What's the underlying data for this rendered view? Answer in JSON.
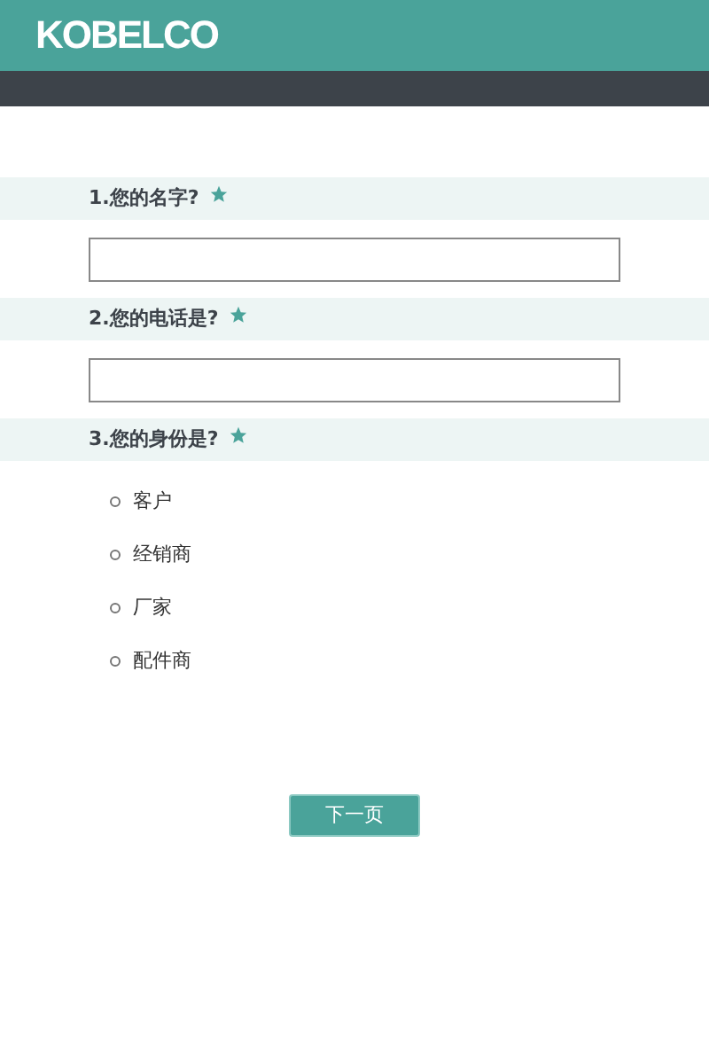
{
  "header": {
    "logo": "KOBELCO"
  },
  "questions": [
    {
      "kind": "text",
      "label": "1.您的名字?",
      "required": true
    },
    {
      "kind": "text",
      "label": "2.您的电话是?",
      "required": true
    },
    {
      "kind": "radio",
      "label": "3.您的身份是?",
      "required": true,
      "options": [
        {
          "label": "客户",
          "selected": false
        },
        {
          "label": "经销商",
          "selected": false
        },
        {
          "label": "厂家",
          "selected": false
        },
        {
          "label": "配件商",
          "selected": false
        }
      ]
    }
  ],
  "next_button": "下一页"
}
